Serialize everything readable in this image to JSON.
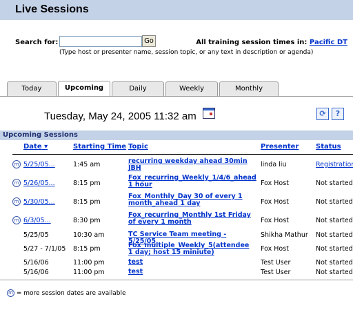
{
  "page": {
    "title": "Live Sessions"
  },
  "search": {
    "label": "Search for:",
    "value": "",
    "go_label": "Go",
    "hint": "(Type host or presenter name, session topic, or any text in description or agenda)"
  },
  "timezone": {
    "label": "All training session times in:",
    "value": "Pacific DT"
  },
  "tabs": [
    {
      "label": "Today",
      "active": false
    },
    {
      "label": "Upcoming",
      "active": true
    },
    {
      "label": "Daily",
      "active": false
    },
    {
      "label": "Weekly",
      "active": false
    },
    {
      "label": "Monthly",
      "active": false
    }
  ],
  "current_datetime": "Tuesday, May 24, 2005 11:32 am",
  "section_title": "Upcoming Sessions",
  "columns": {
    "date": "Date",
    "time": "Starting Time",
    "topic": "Topic",
    "presenter": "Presenter",
    "status": "Status"
  },
  "rows": [
    {
      "date": "5/25/05...",
      "time": "1:45 am",
      "topic": "recurring weekday ahead 30min JBH",
      "presenter": "linda liu",
      "status": "Registration",
      "more": true
    },
    {
      "date": "5/26/05...",
      "time": "8:15 pm",
      "topic": "Fox_recurring_Weekly_1/4/6_ahead 1 hour",
      "presenter": "Fox Host",
      "status": "Not started",
      "more": true
    },
    {
      "date": "5/30/05...",
      "time": "8:15 pm",
      "topic": "Fox_Monthly_Day 30 of every 1 month_ahead 1 day",
      "presenter": "Fox Host",
      "status": "Not started",
      "more": true
    },
    {
      "date": "6/3/05...",
      "time": "8:30 pm",
      "topic": "Fox_recurring_Monthly 1st Friday of every 1 month",
      "presenter": "Fox Host",
      "status": "Not started",
      "more": true
    },
    {
      "date": "5/25/05",
      "time": "10:30 am",
      "topic": "TC Service Team meeting - 5/25/05",
      "presenter": "Shikha Mathur",
      "status": "Not started",
      "more": false
    },
    {
      "date": "5/27 - 7/1/05",
      "time": "8:15 pm",
      "topic": "Fox_multiple_Weekly_5(attendee 1 day; host 15 miniute)",
      "presenter": "Fox Host",
      "status": "Not started",
      "more": false
    },
    {
      "date": "5/16/06",
      "time": "11:00 pm",
      "topic": "test",
      "presenter": "Test User",
      "status": "Not started",
      "more": false
    },
    {
      "date": "5/16/06",
      "time": "11:00 pm",
      "topic": "test",
      "presenter": "Test User",
      "status": "Not started",
      "more": false
    }
  ],
  "legend": "= more session dates are available",
  "icons": {
    "more": "more-dates-icon",
    "calendar": "calendar-icon",
    "refresh": "refresh-icon",
    "help": "help-icon",
    "sort": "sort-desc-icon"
  },
  "colors": {
    "header_bar": "#c4d2e8",
    "link": "#0033cc"
  }
}
